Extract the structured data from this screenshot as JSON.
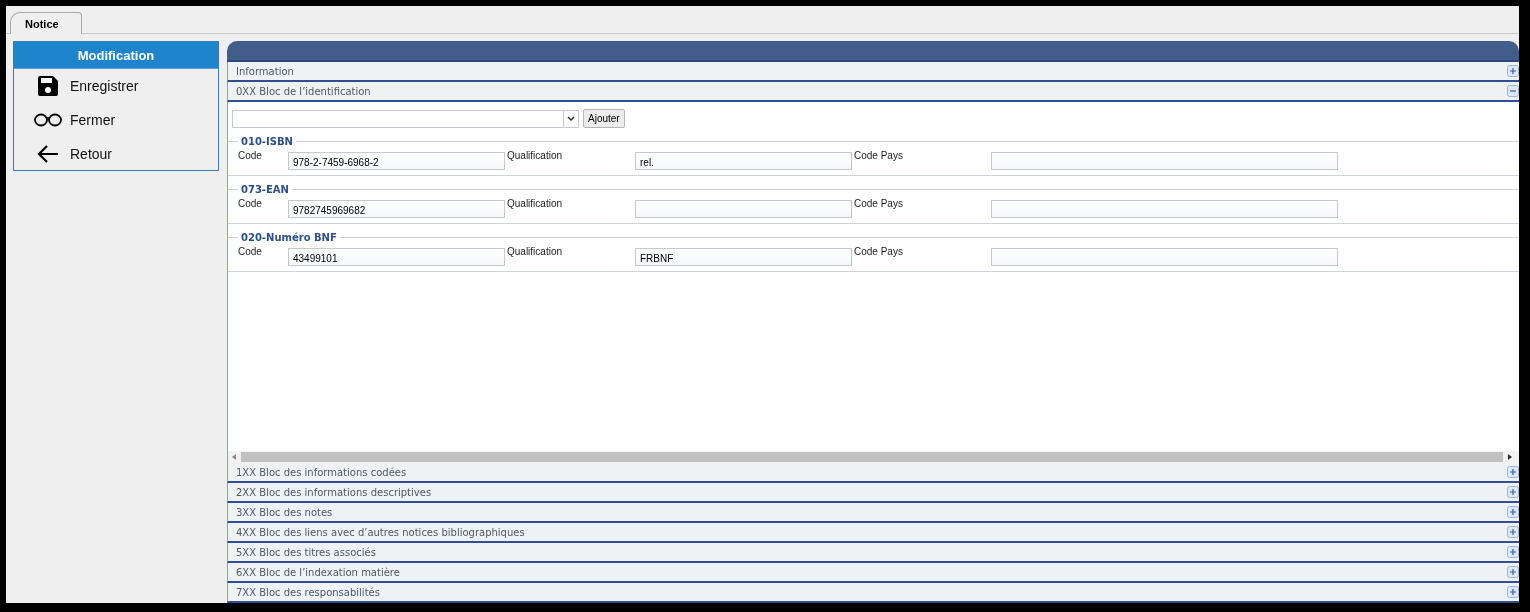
{
  "tabs": [
    {
      "label": "Notice",
      "selected": true
    }
  ],
  "sidebar": {
    "title": "Modification",
    "items": [
      {
        "label": "Enregistrer",
        "kind": "save"
      },
      {
        "label": "Fermer",
        "kind": "glasses"
      },
      {
        "label": "Retour",
        "kind": "back"
      }
    ]
  },
  "sections": [
    {
      "title": "Information",
      "expanded": false
    },
    {
      "title": "0XX Bloc de l’identification",
      "expanded": true,
      "add_button": "Ajouter",
      "groups": [
        {
          "title": "010-ISBN",
          "fields": [
            {
              "label": "Code",
              "value": "978-2-7459-6968-2"
            },
            {
              "label": "Qualification",
              "value": "rel."
            },
            {
              "label": "Code Pays"
            }
          ]
        },
        {
          "title": "073-EAN",
          "fields": [
            {
              "label": "Code",
              "value": "9782745969682"
            },
            {
              "label": "Qualification"
            },
            {
              "label": "Code Pays"
            }
          ]
        },
        {
          "title": "020-Numéro BNF",
          "fields": [
            {
              "label": "Code",
              "value": "43499101"
            },
            {
              "label": "Qualification",
              "value": "FRBNF"
            },
            {
              "label": "Code Pays"
            }
          ]
        }
      ]
    },
    {
      "title": "1XX Bloc des informations codées",
      "expanded": false
    },
    {
      "title": "2XX Bloc des informations descriptives",
      "expanded": false
    },
    {
      "title": "3XX Bloc des notes",
      "expanded": false
    },
    {
      "title": "4XX Bloc des liens avec d’autres notices bibliographiques",
      "expanded": false
    },
    {
      "title": "5XX Bloc des titres associés",
      "expanded": false
    },
    {
      "title": "6XX Bloc de l’indexation matière",
      "expanded": false
    },
    {
      "title": "7XX Bloc des responsabilités",
      "expanded": false
    }
  ]
}
